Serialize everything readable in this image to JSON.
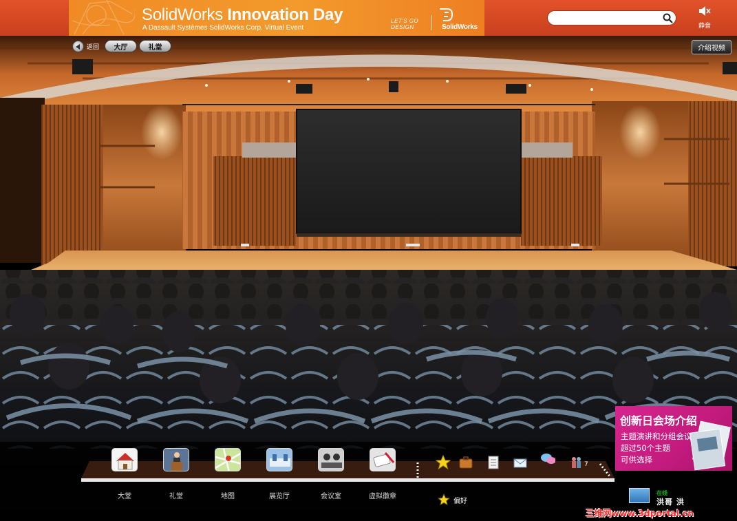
{
  "header": {
    "brand_title_part1": "SolidWorks ",
    "brand_title_part2": "Innovation Day",
    "brand_subtitle": "A Dassault Systèmes SolidWorks Corp. Virtual Event",
    "tagline_line1": "LET'S GO",
    "tagline_line2": "DESIGN",
    "logo_text": "SolidWorks",
    "search": {
      "value": "",
      "placeholder": ""
    },
    "mute_label": "静音"
  },
  "nav": {
    "back_label": "返回",
    "lobby_label": "大厅",
    "auditorium_label": "礼堂",
    "intro_video_label": "介绍视频"
  },
  "dock": {
    "items": [
      {
        "label": "大堂",
        "icon": "house-icon"
      },
      {
        "label": "礼堂",
        "icon": "podium-icon"
      },
      {
        "label": "地图",
        "icon": "map-icon"
      },
      {
        "label": "展览厅",
        "icon": "exhibit-hall-icon"
      },
      {
        "label": "会议室",
        "icon": "meeting-room-icon"
      },
      {
        "label": "虚拟徽章",
        "icon": "virtual-badge-icon"
      }
    ],
    "tools": [
      "star-icon",
      "briefcase-icon",
      "notes-icon",
      "mail-icon",
      "chat-icon",
      "people-icon"
    ],
    "people_count": "7",
    "favorites_label": "偏好"
  },
  "promo": {
    "title": "创新日会场介绍",
    "lines": [
      "主题演讲和分组会议",
      "超过50个主题",
      "可供选择"
    ]
  },
  "user": {
    "status": "在线",
    "name": "洪哥 洪"
  },
  "watermark": "三维网www.3dportal.cn",
  "colors": {
    "banner_red": "#d9482a",
    "banner_orange": "#f39a2c",
    "promo_magenta": "#c21a7d",
    "wood": "#b5652d"
  }
}
